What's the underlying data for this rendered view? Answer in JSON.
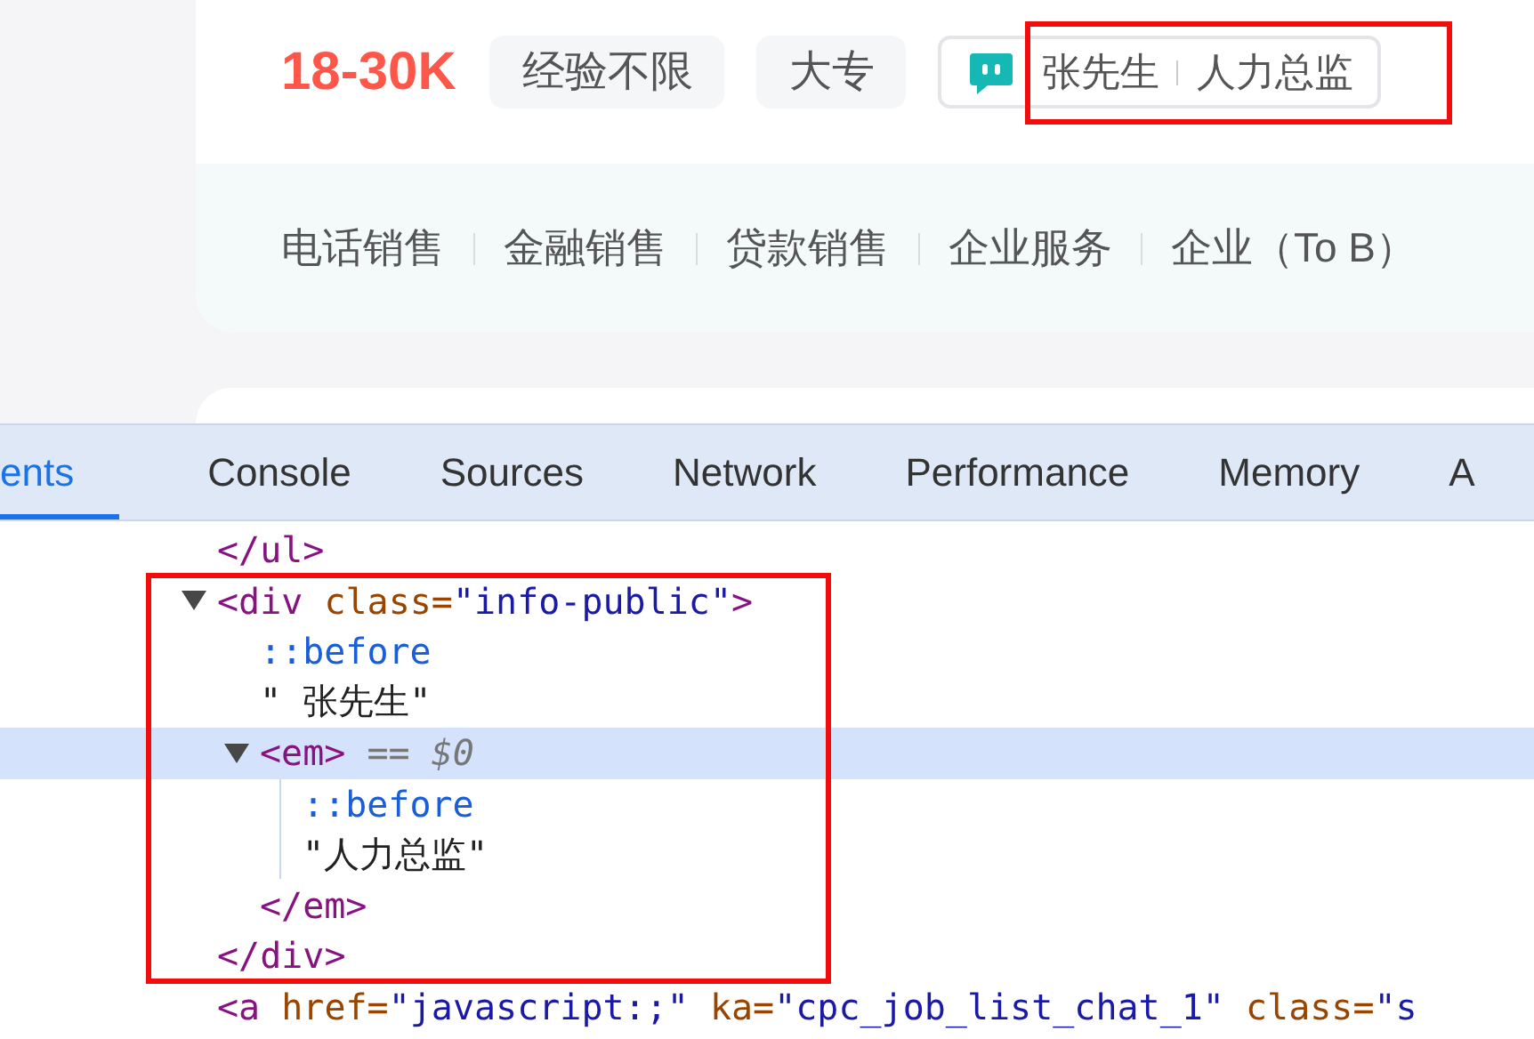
{
  "job": {
    "salary": "18-30K",
    "tags": [
      "经验不限",
      "大专"
    ],
    "recruiter": {
      "name": "张先生",
      "title": "人力总监",
      "highlighted": true
    },
    "categories": [
      "电话销售",
      "金融销售",
      "贷款销售",
      "企业服务",
      "企业（To B）"
    ]
  },
  "devtools": {
    "tabs": [
      {
        "label": "ents",
        "selected": true
      },
      {
        "label": "Console",
        "selected": false
      },
      {
        "label": "Sources",
        "selected": false
      },
      {
        "label": "Network",
        "selected": false
      },
      {
        "label": "Performance",
        "selected": false
      },
      {
        "label": "Memory",
        "selected": false
      },
      {
        "label": "A",
        "selected": false
      }
    ],
    "dom_tree": {
      "highlighted": true,
      "nodes": [
        {
          "selected": false,
          "tokens": [
            {
              "kind": "tag",
              "text": "</ul>"
            }
          ]
        },
        {
          "selected": false,
          "expanded": true,
          "tokens": [
            {
              "kind": "tag",
              "text": "<div"
            },
            {
              "kind": "attr",
              "text": " class="
            },
            {
              "kind": "value",
              "text": "\"info-public\""
            },
            {
              "kind": "tag",
              "text": ">"
            }
          ],
          "children": [
            {
              "selected": false,
              "tokens": [
                {
                  "kind": "pseudo",
                  "text": "::before"
                }
              ]
            },
            {
              "selected": false,
              "tokens": [
                {
                  "kind": "text",
                  "text": "\" 张先生\""
                }
              ]
            },
            {
              "selected": true,
              "expanded": true,
              "tokens": [
                {
                  "kind": "tag",
                  "text": "<em>"
                },
                {
                  "kind": "marker",
                  "text": " == "
                },
                {
                  "kind": "var",
                  "text": "$0"
                }
              ],
              "children": [
                {
                  "selected": false,
                  "tokens": [
                    {
                      "kind": "pseudo",
                      "text": "::before"
                    }
                  ]
                },
                {
                  "selected": false,
                  "tokens": [
                    {
                      "kind": "text",
                      "text": "\"人力总监\""
                    }
                  ]
                }
              ],
              "close_tokens": [
                {
                  "kind": "tag",
                  "text": "</em>"
                }
              ]
            }
          ],
          "close_tokens": [
            {
              "kind": "tag",
              "text": "</div>"
            }
          ]
        },
        {
          "selected": false,
          "tokens": [
            {
              "kind": "tag",
              "text": "<a"
            },
            {
              "kind": "attr",
              "text": " href="
            },
            {
              "kind": "value",
              "text": "\"javascript:;\""
            },
            {
              "kind": "attr",
              "text": " ka="
            },
            {
              "kind": "value",
              "text": "\"cpc_job_list_chat_1\""
            },
            {
              "kind": "attr",
              "text": " class="
            },
            {
              "kind": "value",
              "text": "\"s"
            }
          ]
        }
      ]
    }
  }
}
